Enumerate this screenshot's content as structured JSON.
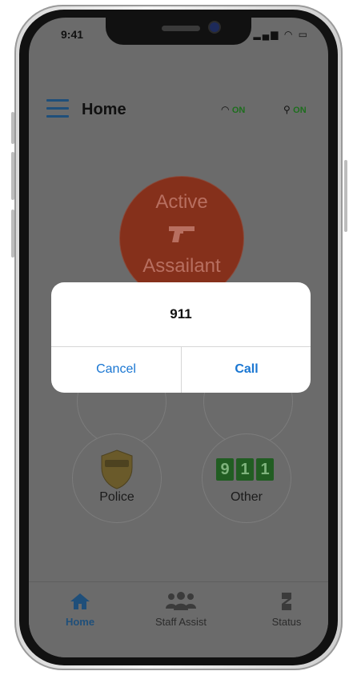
{
  "status_bar": {
    "time": "9:41"
  },
  "header": {
    "title": "Home",
    "wifi_status": "ON",
    "location_status": "ON"
  },
  "main": {
    "emergency_buttons": [
      {
        "line1": "Active",
        "line2": "Assailant"
      },
      {
        "label": "Police"
      },
      {
        "label": "Other",
        "digits": [
          "9",
          "1",
          "1"
        ]
      }
    ]
  },
  "alert": {
    "title": "911",
    "cancel_label": "Cancel",
    "call_label": "Call"
  },
  "tabs": [
    {
      "label": "Home",
      "icon": "home-icon"
    },
    {
      "label": "Staff Assist",
      "icon": "group-icon"
    },
    {
      "label": "Status",
      "icon": "status-icon"
    }
  ],
  "colors": {
    "accent": "#1f4f7a",
    "on_green": "#1d6e1d",
    "alert_button": "#1976d2",
    "assailant": "#85301b"
  }
}
